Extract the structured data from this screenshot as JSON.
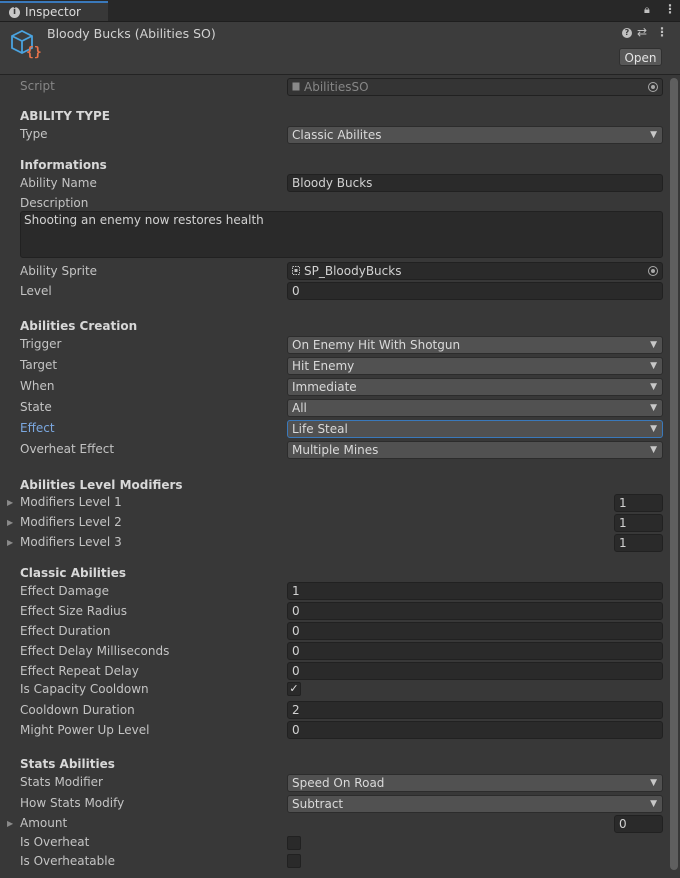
{
  "window": {
    "tab_label": "Inspector",
    "lock_icon": "lock-icon",
    "menu_icon": "kebab-menu-icon"
  },
  "header": {
    "title": "Bloody Bucks (Abilities SO)",
    "asset_icon": "scriptable-object-icon",
    "open_label": "Open"
  },
  "script": {
    "label": "Script",
    "value": "AbilitiesSO"
  },
  "ability_type": {
    "title": "ABILITY TYPE",
    "type_label": "Type",
    "type_value": "Classic Abilites"
  },
  "informations": {
    "title": "Informations",
    "name_label": "Ability Name",
    "name_value": "Bloody Bucks",
    "description_label": "Description",
    "description_value": "Shooting an enemy now restores health",
    "sprite_label": "Ability Sprite",
    "sprite_value": "SP_BloodyBucks",
    "level_label": "Level",
    "level_value": "0"
  },
  "creation": {
    "title": "Abilities Creation",
    "trigger_label": "Trigger",
    "trigger_value": "On Enemy Hit With Shotgun",
    "target_label": "Target",
    "target_value": "Hit Enemy",
    "when_label": "When",
    "when_value": "Immediate",
    "state_label": "State",
    "state_value": "All",
    "effect_label": "Effect",
    "effect_value": "Life Steal",
    "overheat_label": "Overheat Effect",
    "overheat_value": "Multiple Mines"
  },
  "level_modifiers": {
    "title": "Abilities Level Modifiers",
    "items": [
      {
        "label": "Modifiers Level 1",
        "value": "1"
      },
      {
        "label": "Modifiers Level 2",
        "value": "1"
      },
      {
        "label": "Modifiers Level 3",
        "value": "1"
      }
    ]
  },
  "classic": {
    "title": "Classic Abilities",
    "damage_label": "Effect Damage",
    "damage_value": "1",
    "radius_label": "Effect Size Radius",
    "radius_value": "0",
    "duration_label": "Effect Duration",
    "duration_value": "0",
    "delay_label": "Effect Delay Milliseconds",
    "delay_value": "0",
    "repeat_label": "Effect Repeat Delay",
    "repeat_value": "0",
    "capacity_label": "Is Capacity Cooldown",
    "capacity_checked": true,
    "capacity_mark": "✓",
    "cooldown_label": "Cooldown Duration",
    "cooldown_value": "2",
    "might_label": "Might Power Up Level",
    "might_value": "0"
  },
  "stats": {
    "title": "Stats Abilities",
    "modifier_label": "Stats Modifier",
    "modifier_value": "Speed On Road",
    "how_label": "How Stats Modify",
    "how_value": "Subtract",
    "amount_label": "Amount",
    "amount_value": "0",
    "overheat_label": "Is Overheat",
    "overheat_checked": false,
    "overheatable_label": "Is Overheatable",
    "overheatable_checked": false
  },
  "colors": {
    "background": "#383838",
    "accent": "#3a79bb",
    "field": "#2a2a2a",
    "dropdown": "#515151",
    "focused_label": "#7ba8e0"
  }
}
